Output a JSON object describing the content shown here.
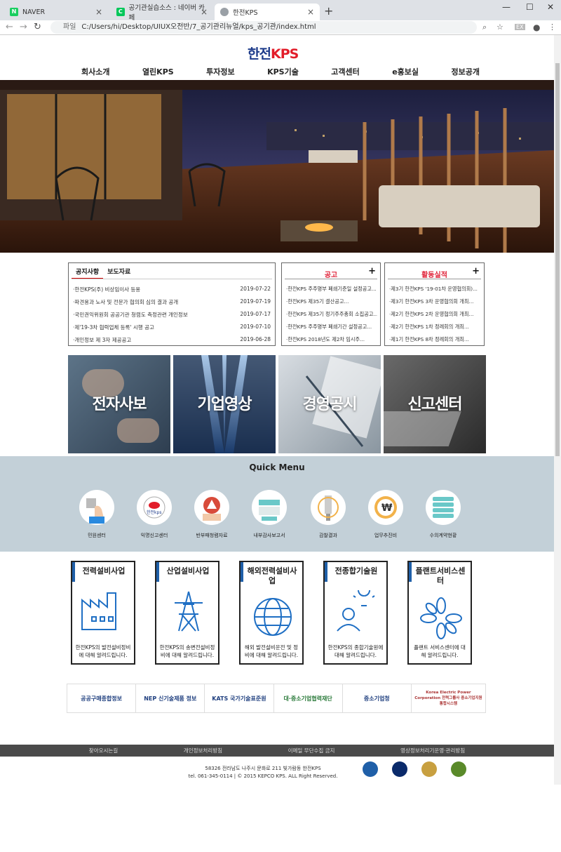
{
  "browser": {
    "tabs": [
      {
        "title": "NAVER",
        "fav": "N",
        "color": "#19ce60"
      },
      {
        "title": "공기관실습소스 : 네이버 카페",
        "fav": "C",
        "color": "#03c75a"
      },
      {
        "title": "한전KPS",
        "fav": "",
        "color": "#9aa0a6"
      }
    ],
    "url_scheme": "파일",
    "url": "C:/Users/hi/Desktop/UIUX오전반/7_공기관리뉴얼/kps_공기관/index.html"
  },
  "logo": {
    "left": "한전",
    "right": "KPS"
  },
  "gnb": [
    "회사소개",
    "열린KPS",
    "투자정보",
    "KPS기술",
    "고객센터",
    "e홍보실",
    "정보공개"
  ],
  "notice": {
    "tabs": [
      "공지사항",
      "보도자료"
    ],
    "rows": [
      {
        "title": "·한전KPS(주) 비상임이사 등용",
        "date": "2019-07-22"
      },
      {
        "title": "·파견용과 노사 및 전문가 협의회 심의 결과 공개",
        "date": "2019-07-19"
      },
      {
        "title": "·국민권익위원회 공공기관 청렴도 측정관련 개인정보",
        "date": "2019-07-17"
      },
      {
        "title": "·제'19-3차 협력업체 등록' 시행 공고",
        "date": "2019-07-10"
      },
      {
        "title": "·개인정보 제 3자 제공공고",
        "date": "2019-06-28"
      }
    ]
  },
  "announce": {
    "title": "공고",
    "rows": [
      "·한전KPS 주주명부 폐쇄기준일 설정공고...",
      "·한전KPS 제35기 결산공고...",
      "·한전KPS 제35기 정기주주총회 소집공고...",
      "·한전KPS 주주명부 폐쇄기간 설정공고...",
      "·한전KPS 2018년도 제2차 임시주..."
    ]
  },
  "activity": {
    "title": "활동실적",
    "rows": [
      "·제3기 한전KPS '19-01차 운영협의회)...",
      "·제3기 한전KPS 3차 운영협의회 개최...",
      "·제2기 한전KPS 2차 운영협의회 개최...",
      "·제2기 한전KPS 1차 정례회의 개최...",
      "·제1기 한전KPS 8차 정례회의 개최..."
    ]
  },
  "banners": [
    "전자사보",
    "기업영상",
    "경영공시",
    "신고센터"
  ],
  "quick": {
    "title": "Quick Menu",
    "items": [
      "민원센터",
      "익명신고센터",
      "반부패청렴자료",
      "내부감사보고서",
      "감찰결과",
      "업무추진비",
      "수의계약현황"
    ]
  },
  "business": [
    {
      "title": "전력설비사업",
      "desc": "한전KPS의 발전설비정비에 대해 알려드립니다."
    },
    {
      "title": "산업설비사업",
      "desc": "한전KPS의 송변전설비정비에 대해 알려드립니다."
    },
    {
      "title": "해외전력설비사업",
      "desc": "해외 발전설비운전 및 정비에 대해 알려드립니다."
    },
    {
      "title": "전종합기술원",
      "desc": "한전KPS의 종합기술원에 대해 알려드립니다."
    },
    {
      "title": "플랜트서비스센터",
      "desc": "플랜트 서비스센터에 대해 알려드립니다."
    }
  ],
  "partners": [
    "공공구매종합정보",
    "NEP 신기술제품 정보",
    "KATS 국가기술표준원",
    "대·중소기업협력재단",
    "중소기업청",
    "Korea Electric Power Corporation 전력그룹사 중소기업지원 통합시스템"
  ],
  "footer": {
    "links": [
      "찾아오시는길",
      "개인정보처리방침",
      "이메일 무단수집 금지",
      "영상정보처리기운영·관리방침"
    ],
    "address": "58326 전라남도 나주시 문화로 211 빛가람동 한전KPS",
    "copyright": "tel. 061-345-0114  |  © 2015 KEPCO KPS. ALL Right Reserved."
  }
}
